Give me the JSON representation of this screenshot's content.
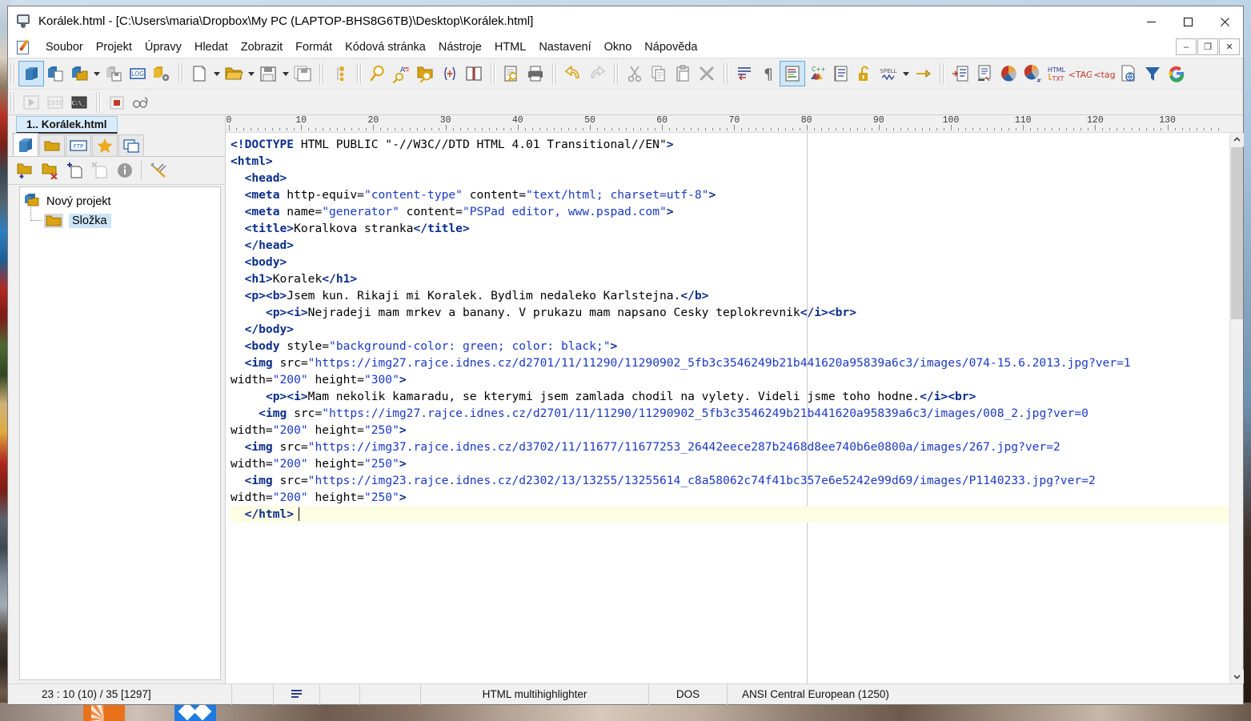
{
  "window": {
    "title": "Korálek.html - [C:\\Users\\maria\\Dropbox\\My PC (LAPTOP-BHS8G6TB)\\Desktop\\Korálek.html]",
    "controls": {
      "minimize": "—",
      "maximize": "□",
      "close": "✕"
    },
    "mdi_controls": {
      "minimize": "–",
      "restore": "❐",
      "close": "✕"
    }
  },
  "menu": {
    "items": [
      "Soubor",
      "Projekt",
      "Úpravy",
      "Hledat",
      "Zobrazit",
      "Formát",
      "Kódová stránka",
      "Nástroje",
      "HTML",
      "Nastavení",
      "Okno",
      "Nápověda"
    ]
  },
  "toolbar": {
    "groups": [
      {
        "name": "project",
        "buttons": [
          "project-open-icon",
          "project-new-icon",
          "project-add-file-icon",
          "dropdown-arrow-icon",
          "project-save-icon",
          "log-icon",
          "project-settings-icon"
        ]
      },
      {
        "name": "file",
        "buttons": [
          "new-file-icon",
          "dropdown-arrow-icon",
          "open-file-icon",
          "dropdown-arrow-icon",
          "save-file-icon",
          "dropdown-arrow-icon",
          "save-all-icon"
        ]
      },
      {
        "name": "navigation",
        "buttons": [
          "bookmark-icon"
        ]
      },
      {
        "name": "search",
        "buttons": [
          "find-icon",
          "replace-icon",
          "find-in-files-icon",
          "regex-icon",
          "book-icon"
        ]
      },
      {
        "name": "print",
        "buttons": [
          "print-preview-icon",
          "print-icon"
        ]
      },
      {
        "name": "undo",
        "buttons": [
          "undo-icon",
          "redo-icon"
        ]
      },
      {
        "name": "clipboard",
        "buttons": [
          "cut-icon",
          "copy-icon",
          "paste-icon",
          "delete-icon"
        ]
      },
      {
        "name": "format",
        "buttons": [
          "indent-icon",
          "pilcrow-icon",
          "highlight-icon",
          "cpp-icon",
          "line-numbers-icon",
          "lock-icon",
          "spell-check-icon",
          "dropdown-arrow-icon",
          "pin-icon"
        ]
      },
      {
        "name": "html-tools",
        "buttons": [
          "format-code-icon",
          "compress-icon",
          "color-chart-icon",
          "color-chart-10-icon",
          "html-to-text-icon",
          "tag-open-icon",
          "tag-close-icon",
          "web-preview-icon",
          "filter-icon",
          "google-icon"
        ]
      }
    ],
    "row2_buttons": [
      "run-icon",
      "binary-icon",
      "console-icon",
      "stop-icon",
      "glasses-icon"
    ]
  },
  "document_tab": {
    "label": "1.. Korálek.html"
  },
  "left_panel": {
    "tabs": [
      "projects-tab",
      "explorer-tab",
      "ftp-tab",
      "favorites-tab",
      "windows-tab"
    ],
    "toolbar": [
      "add-folder-icon",
      "remove-folder-icon",
      "add-file-icon",
      "remove-file-icon",
      "info-icon",
      "settings-icon"
    ],
    "tree": {
      "root": "Nový projekt",
      "children": [
        "Složka"
      ]
    }
  },
  "ruler": {
    "labels": [
      0,
      10,
      20,
      30,
      40,
      50,
      60,
      70,
      80,
      90,
      100,
      110,
      120,
      130
    ],
    "right_margin_column": 80
  },
  "editor": {
    "caret_line_index": 22,
    "lines": [
      {
        "i": 0,
        "segments": [
          {
            "t": "tag",
            "s": "<!DOCTYPE"
          },
          {
            "t": "txt",
            "s": " HTML PUBLIC \"-//W3C//DTD HTML 4.01 Transitional//EN\""
          },
          {
            "t": "tag",
            "s": ">"
          }
        ]
      },
      {
        "i": 1,
        "segments": [
          {
            "t": "tag",
            "s": "<html>"
          }
        ]
      },
      {
        "i": 2,
        "segments": [
          {
            "t": "txt",
            "s": "  "
          },
          {
            "t": "tag",
            "s": "<head>"
          }
        ]
      },
      {
        "i": 3,
        "segments": [
          {
            "t": "txt",
            "s": "  "
          },
          {
            "t": "tag",
            "s": "<meta"
          },
          {
            "t": "attr",
            "s": " http-equiv="
          },
          {
            "t": "val",
            "s": "\"content-type\""
          },
          {
            "t": "attr",
            "s": " content="
          },
          {
            "t": "val",
            "s": "\"text/html; charset=utf-8\""
          },
          {
            "t": "tag",
            "s": ">"
          }
        ]
      },
      {
        "i": 4,
        "segments": [
          {
            "t": "txt",
            "s": "  "
          },
          {
            "t": "tag",
            "s": "<meta"
          },
          {
            "t": "attr",
            "s": " name="
          },
          {
            "t": "val",
            "s": "\"generator\""
          },
          {
            "t": "attr",
            "s": " content="
          },
          {
            "t": "val",
            "s": "\"PSPad editor, www.pspad.com\""
          },
          {
            "t": "tag",
            "s": ">"
          }
        ]
      },
      {
        "i": 5,
        "segments": [
          {
            "t": "txt",
            "s": "  "
          },
          {
            "t": "tag",
            "s": "<title>"
          },
          {
            "t": "txt",
            "s": "Koralkova stranka"
          },
          {
            "t": "tag",
            "s": "</title>"
          }
        ]
      },
      {
        "i": 6,
        "segments": [
          {
            "t": "txt",
            "s": "  "
          },
          {
            "t": "tag",
            "s": "</head>"
          }
        ]
      },
      {
        "i": 7,
        "segments": [
          {
            "t": "txt",
            "s": "  "
          },
          {
            "t": "tag",
            "s": "<body>"
          }
        ]
      },
      {
        "i": 8,
        "segments": [
          {
            "t": "txt",
            "s": "  "
          },
          {
            "t": "tag",
            "s": "<h1>"
          },
          {
            "t": "txt",
            "s": "Koralek"
          },
          {
            "t": "tag",
            "s": "</h1>"
          }
        ]
      },
      {
        "i": 9,
        "segments": [
          {
            "t": "txt",
            "s": "  "
          },
          {
            "t": "tag",
            "s": "<p><b>"
          },
          {
            "t": "txt",
            "s": "Jsem kun. Rikaji mi Koralek. Bydlim nedaleko Karlstejna."
          },
          {
            "t": "tag",
            "s": "</b>"
          }
        ]
      },
      {
        "i": 10,
        "segments": [
          {
            "t": "txt",
            "s": "     "
          },
          {
            "t": "tag",
            "s": "<p><i>"
          },
          {
            "t": "txt",
            "s": "Nejradeji mam mrkev a banany. V prukazu mam napsano Cesky teplokrevnik"
          },
          {
            "t": "tag",
            "s": "</i><br>"
          }
        ]
      },
      {
        "i": 11,
        "segments": [
          {
            "t": "txt",
            "s": "  "
          },
          {
            "t": "tag",
            "s": "</body>"
          }
        ]
      },
      {
        "i": 12,
        "segments": [
          {
            "t": "txt",
            "s": "  "
          },
          {
            "t": "tag",
            "s": "<body"
          },
          {
            "t": "attr",
            "s": " style="
          },
          {
            "t": "val",
            "s": "\"background-color: green; color: black;\""
          },
          {
            "t": "tag",
            "s": ">"
          }
        ]
      },
      {
        "i": 13,
        "segments": [
          {
            "t": "txt",
            "s": "  "
          },
          {
            "t": "tag",
            "s": "<img"
          },
          {
            "t": "attr",
            "s": " src="
          },
          {
            "t": "val",
            "s": "\"https://img27.rajce.idnes.cz/d2701/11/11290/11290902_5fb3c3546249b21b441620a95839a6c3/images/074-15.6.2013.jpg?ver=1"
          }
        ]
      },
      {
        "i": 14,
        "segments": [
          {
            "t": "attr",
            "s": "width="
          },
          {
            "t": "val",
            "s": "\"200\""
          },
          {
            "t": "attr",
            "s": " height="
          },
          {
            "t": "val",
            "s": "\"300\""
          },
          {
            "t": "tag",
            "s": ">"
          }
        ]
      },
      {
        "i": 15,
        "segments": [
          {
            "t": "txt",
            "s": "     "
          },
          {
            "t": "tag",
            "s": "<p><i>"
          },
          {
            "t": "txt",
            "s": "Mam nekolik kamaradu, se kterymi jsem zamlada chodil na vylety. Videli jsme toho hodne."
          },
          {
            "t": "tag",
            "s": "</i><br>"
          }
        ]
      },
      {
        "i": 16,
        "segments": [
          {
            "t": "txt",
            "s": "    "
          },
          {
            "t": "tag",
            "s": "<img"
          },
          {
            "t": "attr",
            "s": " src="
          },
          {
            "t": "val",
            "s": "\"https://img27.rajce.idnes.cz/d2701/11/11290/11290902_5fb3c3546249b21b441620a95839a6c3/images/008_2.jpg?ver=0"
          }
        ]
      },
      {
        "i": 17,
        "segments": [
          {
            "t": "attr",
            "s": "width="
          },
          {
            "t": "val",
            "s": "\"200\""
          },
          {
            "t": "attr",
            "s": " height="
          },
          {
            "t": "val",
            "s": "\"250\""
          },
          {
            "t": "tag",
            "s": ">"
          }
        ]
      },
      {
        "i": 18,
        "segments": [
          {
            "t": "txt",
            "s": "  "
          },
          {
            "t": "tag",
            "s": "<img"
          },
          {
            "t": "attr",
            "s": " src="
          },
          {
            "t": "val",
            "s": "\"https://img37.rajce.idnes.cz/d3702/11/11677/11677253_26442eece287b2468d8ee740b6e0800a/images/267.jpg?ver=2"
          }
        ]
      },
      {
        "i": 19,
        "segments": [
          {
            "t": "attr",
            "s": "width="
          },
          {
            "t": "val",
            "s": "\"200\""
          },
          {
            "t": "attr",
            "s": " height="
          },
          {
            "t": "val",
            "s": "\"250\""
          },
          {
            "t": "tag",
            "s": ">"
          }
        ]
      },
      {
        "i": 20,
        "segments": [
          {
            "t": "txt",
            "s": "  "
          },
          {
            "t": "tag",
            "s": "<img"
          },
          {
            "t": "attr",
            "s": " src="
          },
          {
            "t": "val",
            "s": "\"https://img23.rajce.idnes.cz/d2302/13/13255/13255614_c8a58062c74f41bc357e6e5242e99d69/images/P1140233.jpg?ver=2"
          }
        ]
      },
      {
        "i": 21,
        "segments": [
          {
            "t": "attr",
            "s": "width="
          },
          {
            "t": "val",
            "s": "\"200\""
          },
          {
            "t": "attr",
            "s": " height="
          },
          {
            "t": "val",
            "s": "\"250\""
          },
          {
            "t": "tag",
            "s": ">"
          }
        ]
      },
      {
        "i": 22,
        "segments": [
          {
            "t": "txt",
            "s": "  "
          },
          {
            "t": "tag",
            "s": "</html>"
          }
        ]
      }
    ]
  },
  "status_bar": {
    "caret": "23 : 10 (10) / 35  [1297]",
    "wrap_icon": "word-wrap-icon",
    "highlighter": "HTML multihighlighter",
    "eol": "DOS",
    "encoding": "ANSI Central European (1250)"
  },
  "colors": {
    "tag": "#0b2e8a",
    "value": "#1a39c6",
    "current_line": "#fdfde4",
    "selection": "#cde5f7",
    "toolbar_bg": "#f0f0f0"
  }
}
